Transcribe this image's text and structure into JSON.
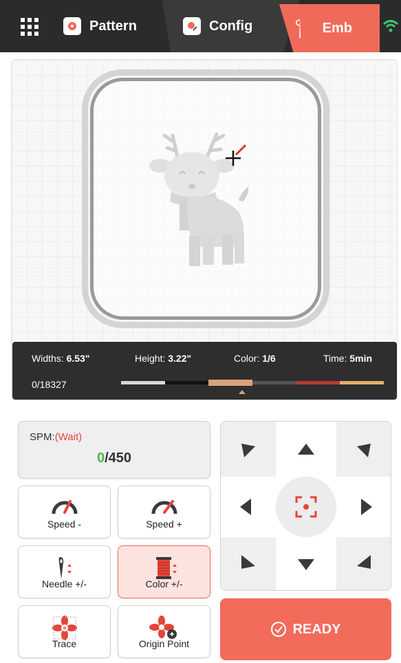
{
  "header": {
    "tabs": [
      {
        "label": "Pattern"
      },
      {
        "label": "Config"
      },
      {
        "label": "Emb"
      }
    ]
  },
  "info": {
    "width_label": "Widths:",
    "width_value": "6.53\"",
    "height_label": "Height:",
    "height_value": "3.22\"",
    "color_label": "Color:",
    "color_value": "1/6",
    "time_label": "Time:",
    "time_value": "5min",
    "stitch_progress": "0/18327",
    "color_segments": [
      "#d9d9d9",
      "#111111",
      "#d8a27a",
      "#555555",
      "#b83a34",
      "#e3b06a"
    ],
    "selected_color_index": 2
  },
  "spm": {
    "label": "SPM:",
    "status": "(Wait)",
    "current": "0",
    "max": "/450"
  },
  "buttons": {
    "speed_down": "Speed -",
    "speed_up": "Speed +",
    "needle": "Needle +/-",
    "color": "Color +/-",
    "trace": "Trace",
    "origin": "Origin Point",
    "ready": "READY"
  },
  "colors": {
    "accent": "#f06a5a",
    "topbar": "#2b2b2b",
    "wifi": "#3ec46d",
    "spm_current": "#4cb84c",
    "wait": "#e5453a"
  }
}
